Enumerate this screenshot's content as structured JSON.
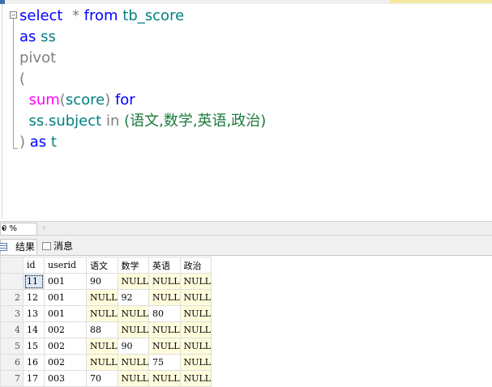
{
  "editor": {
    "line1": {
      "kw1": "select",
      "gap": "  ",
      "star": "*",
      "kw2": "from",
      "table": "tb_score"
    },
    "line2": {
      "kw": "as",
      "alias": "ss"
    },
    "line3": {
      "kw": "pivot"
    },
    "line4": {
      "paren": "("
    },
    "line5": {
      "func": "sum",
      "open": "(",
      "col": "score",
      "close": ")",
      "kw": "for"
    },
    "line6": {
      "alias": "ss",
      "dot": ".",
      "col": "subject",
      "kw": "in",
      "list": "(语文,数学,英语,政治)"
    },
    "line7": {
      "paren": ")",
      "kw": "as",
      "alias": "t"
    }
  },
  "zoom": {
    "value": "0 %",
    "dropdown_arrow": "▾",
    "scroll_arrow": "‹"
  },
  "tabs": [
    {
      "label": "结果",
      "icon": "results-grid-icon",
      "active": true
    },
    {
      "label": "消息",
      "icon": "messages-icon",
      "active": false
    }
  ],
  "grid": {
    "columns": [
      "id",
      "userid",
      "语文",
      "数学",
      "英语",
      "政治"
    ],
    "rows": [
      {
        "rownum": "",
        "cells": [
          "11",
          "001",
          "90",
          "NULL",
          "NULL",
          "NULL"
        ]
      },
      {
        "rownum": "2",
        "cells": [
          "12",
          "001",
          "NULL",
          "92",
          "NULL",
          "NULL"
        ]
      },
      {
        "rownum": "3",
        "cells": [
          "13",
          "001",
          "NULL",
          "NULL",
          "80",
          "NULL"
        ]
      },
      {
        "rownum": "4",
        "cells": [
          "14",
          "002",
          "88",
          "NULL",
          "NULL",
          "NULL"
        ]
      },
      {
        "rownum": "5",
        "cells": [
          "15",
          "002",
          "NULL",
          "90",
          "NULL",
          "NULL"
        ]
      },
      {
        "rownum": "6",
        "cells": [
          "16",
          "002",
          "NULL",
          "NULL",
          "75",
          "NULL"
        ]
      },
      {
        "rownum": "7",
        "cells": [
          "17",
          "003",
          "70",
          "NULL",
          "NULL",
          "NULL"
        ]
      }
    ]
  },
  "colors": {
    "keyword": "#0000ff",
    "identifier": "#008080",
    "function": "#ff00ff",
    "null_cell": "#fffcdc"
  }
}
